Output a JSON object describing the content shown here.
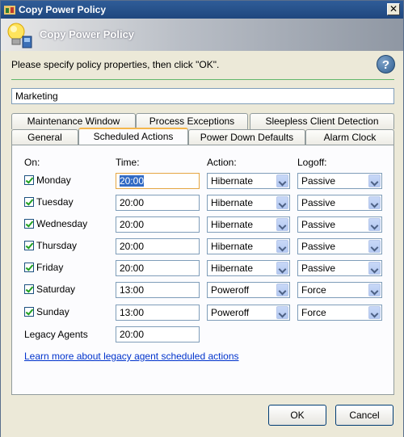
{
  "window": {
    "title": "Copy Power Policy",
    "close_glyph": "✕"
  },
  "banner": {
    "title": "Copy Power Policy",
    "icon": "lightbulb-icon"
  },
  "instruction": "Please specify policy properties, then click \"OK\".",
  "help_glyph": "?",
  "policy_name": "Marketing",
  "tabs_row1": [
    {
      "label": "Maintenance Window"
    },
    {
      "label": "Process Exceptions"
    },
    {
      "label": "Sleepless Client Detection"
    }
  ],
  "tabs_row2": [
    {
      "label": "General"
    },
    {
      "label": "Scheduled Actions",
      "active": true
    },
    {
      "label": "Power Down Defaults"
    },
    {
      "label": "Alarm Clock"
    }
  ],
  "schedule": {
    "headers": {
      "on": "On:",
      "time": "Time:",
      "action": "Action:",
      "logoff": "Logoff:"
    },
    "days": [
      {
        "day": "Monday",
        "checked": true,
        "time": "20:00",
        "action": "Hibernate",
        "logoff": "Passive"
      },
      {
        "day": "Tuesday",
        "checked": true,
        "time": "20:00",
        "action": "Hibernate",
        "logoff": "Passive"
      },
      {
        "day": "Wednesday",
        "checked": true,
        "time": "20:00",
        "action": "Hibernate",
        "logoff": "Passive"
      },
      {
        "day": "Thursday",
        "checked": true,
        "time": "20:00",
        "action": "Hibernate",
        "logoff": "Passive"
      },
      {
        "day": "Friday",
        "checked": true,
        "time": "20:00",
        "action": "Hibernate",
        "logoff": "Passive"
      },
      {
        "day": "Saturday",
        "checked": true,
        "time": "13:00",
        "action": "Poweroff",
        "logoff": "Force"
      },
      {
        "day": "Sunday",
        "checked": true,
        "time": "13:00",
        "action": "Poweroff",
        "logoff": "Force"
      }
    ],
    "legacy_label": "Legacy Agents",
    "legacy_time": "20:00",
    "legacy_link": "Learn more about legacy agent scheduled actions"
  },
  "buttons": {
    "ok": "OK",
    "cancel": "Cancel"
  }
}
